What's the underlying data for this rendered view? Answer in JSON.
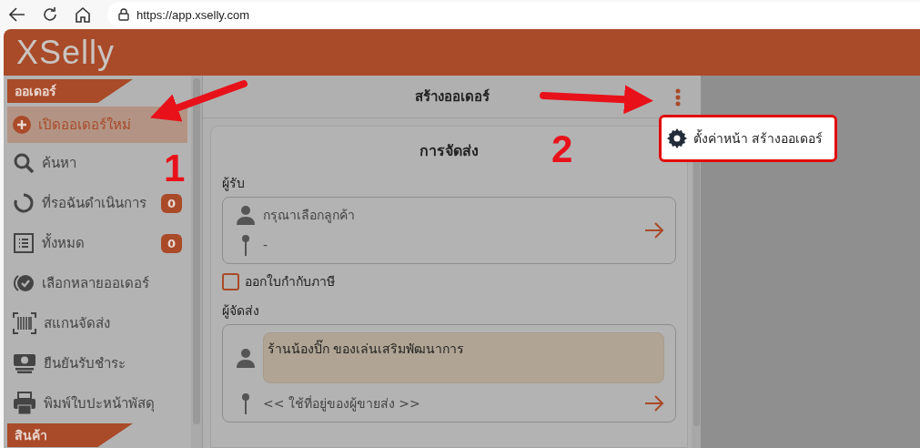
{
  "browser": {
    "url": "https://app.xselly.com"
  },
  "app": {
    "logo": "XSelly"
  },
  "sidebar": {
    "sections": [
      {
        "title": "ออเดอร์",
        "items": [
          {
            "label": "เปิดออเดอร์ใหม่",
            "selected": true
          },
          {
            "label": "ค้นหา",
            "selected": false
          },
          {
            "label": "ที่รอฉันดำเนินการ",
            "selected": false,
            "badge": "0"
          },
          {
            "label": "ทั้งหมด",
            "selected": false,
            "badge": "0"
          },
          {
            "label": "เลือกหลายออเดอร์",
            "selected": false
          },
          {
            "label": "สแกนจัดส่ง",
            "selected": false
          },
          {
            "label": "ยืนยันรับชำระ",
            "selected": false
          },
          {
            "label": "พิมพ์ใบปะหน้าพัสดุ",
            "selected": false
          }
        ]
      },
      {
        "title": "สินค้า"
      }
    ]
  },
  "header": {
    "title": "สร้างออเดอร์"
  },
  "menu": {
    "items": [
      {
        "label": "ตั้งค่าหน้า สร้างออเดอร์"
      }
    ]
  },
  "card": {
    "title": "การจัดส่ง",
    "recipient": {
      "label": "ผู้รับ",
      "placeholder": "กรุณาเลือกลูกค้า",
      "address": "-"
    },
    "tax_invoice": {
      "label": "ออกใบกำกับภาษี",
      "checked": false
    },
    "sender": {
      "label": "ผู้จัดส่ง",
      "name": "ร้านน้องปิ๊ก ของเล่นเสริมพัฒนาการ",
      "address": "<< ใช้ที่อยู่ของผู้ขายส่ง >>"
    }
  },
  "annotations": [
    {
      "text": "1"
    },
    {
      "text": "2"
    }
  ]
}
